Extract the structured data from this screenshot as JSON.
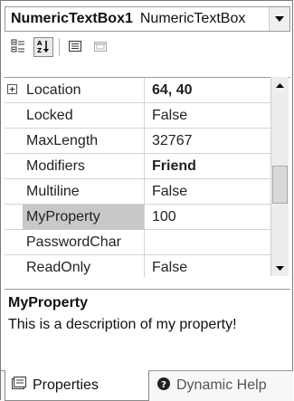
{
  "object_selector": {
    "name": "NumericTextBox1",
    "type": "NumericTextBox"
  },
  "toolbar": {
    "buttons": [
      {
        "name": "categorized-view",
        "icon": "categorized-icon"
      },
      {
        "name": "alphabetical-view",
        "icon": "sort-az-icon",
        "pressed": true
      },
      {
        "name": "properties",
        "icon": "properties-icon"
      },
      {
        "name": "property-pages",
        "icon": "property-pages-icon",
        "disabled": true
      }
    ]
  },
  "properties": [
    {
      "name": "Location",
      "value": "64, 40",
      "expandable": true,
      "bold": true
    },
    {
      "name": "Locked",
      "value": "False"
    },
    {
      "name": "MaxLength",
      "value": "32767"
    },
    {
      "name": "Modifiers",
      "value": "Friend",
      "bold": true
    },
    {
      "name": "Multiline",
      "value": "False"
    },
    {
      "name": "MyProperty",
      "value": "100",
      "selected": true
    },
    {
      "name": "PasswordChar",
      "value": ""
    },
    {
      "name": "ReadOnly",
      "value": "False"
    }
  ],
  "description": {
    "title": "MyProperty",
    "text": "This is a description of my property!"
  },
  "tabs": [
    {
      "label": "Properties",
      "active": true,
      "icon": "properties-tab-icon"
    },
    {
      "label": "Dynamic Help",
      "active": false,
      "icon": "help-icon"
    }
  ]
}
